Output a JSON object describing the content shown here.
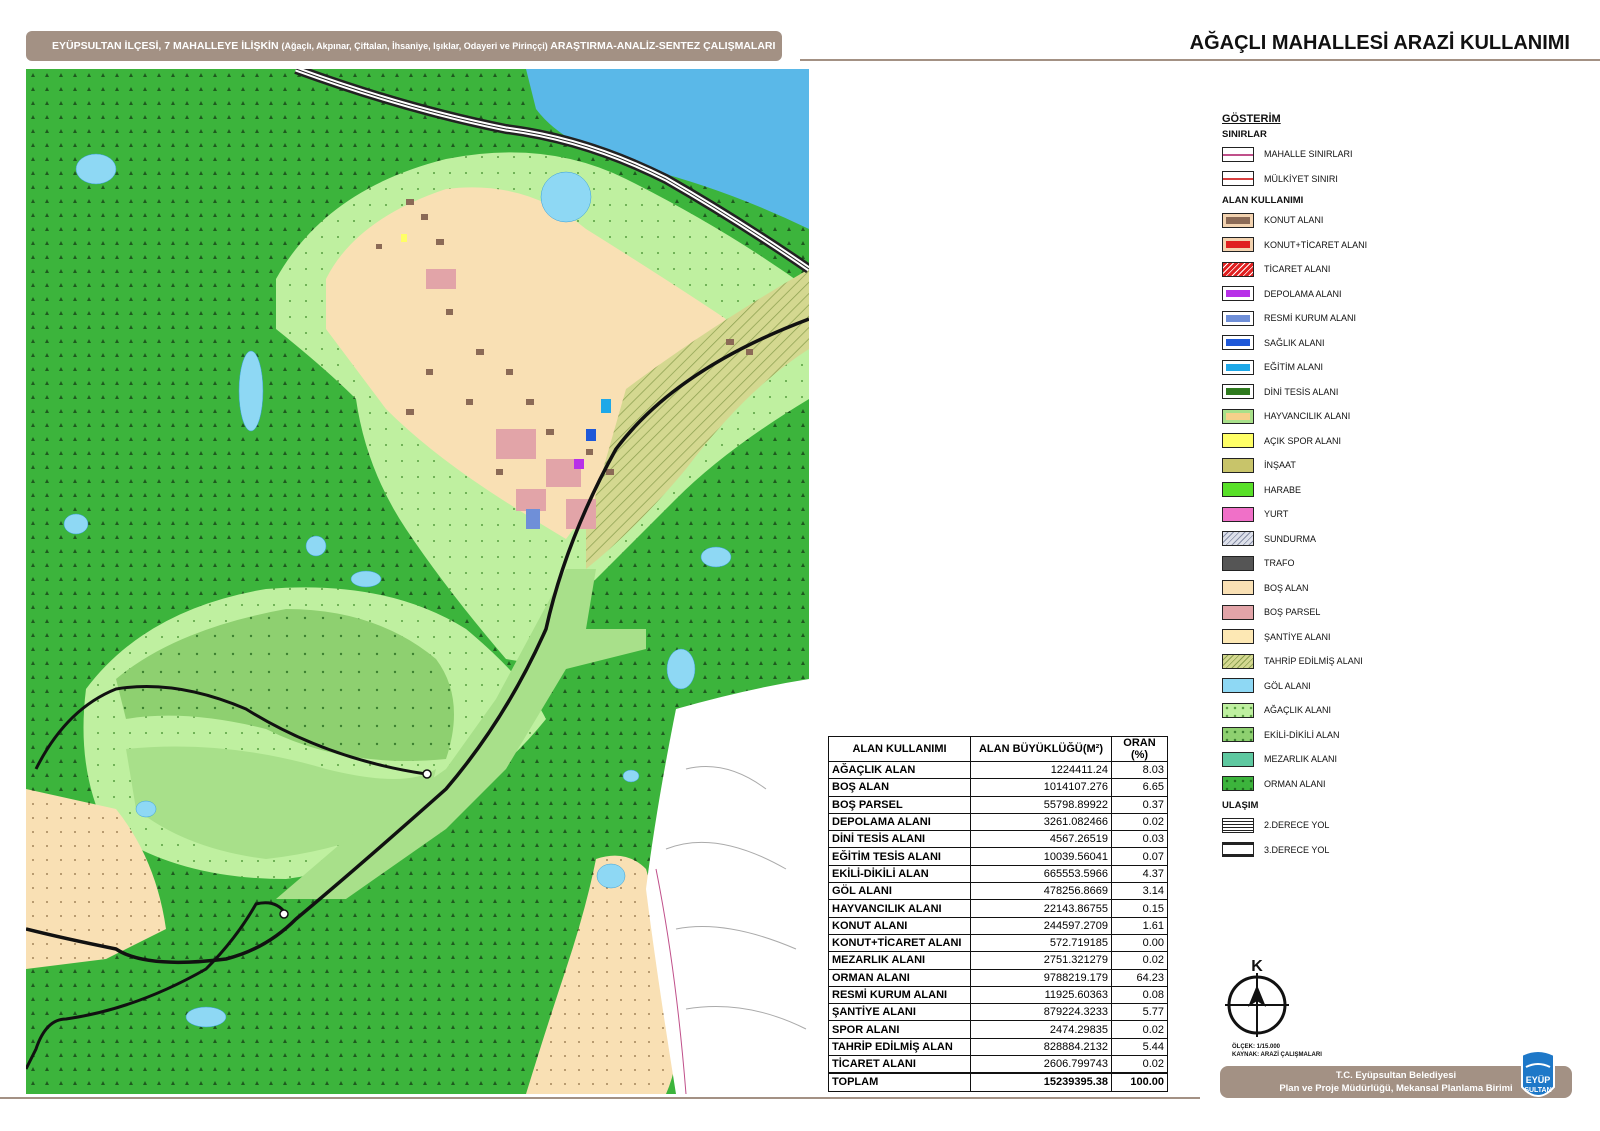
{
  "header": {
    "main": "EYÜPSULTAN İLÇESİ, 7 MAHALLEYE İLİŞKİN",
    "sub": "(Ağaçlı, Akpınar, Çiftalan, İhsaniye, Işıklar, Odayeri ve Pirinççi)",
    "tail": "ARAŞTIRMA-ANALİZ-SENTEZ ÇALIŞMALARI"
  },
  "title": "AĞAÇLI MAHALLESİ ARAZİ KULLANIMI",
  "legend": {
    "heading": "GÖSTERİM",
    "sections": [
      {
        "title": "SINIRLAR",
        "items": [
          {
            "label": "MAHALLE SINIRLARI",
            "fill": "#ffffff",
            "line": "#c0508a",
            "style": "line"
          },
          {
            "label": "MÜLKİYET SINIRI",
            "fill": "#ffffff",
            "line": "#d84040",
            "style": "line"
          }
        ]
      },
      {
        "title": "ALAN KULLANIMI",
        "items": [
          {
            "label": "KONUT ALANI",
            "fill": "#8b6a56",
            "line": "#f3d3b0",
            "style": "inner"
          },
          {
            "label": "KONUT+TİCARET ALANI",
            "fill": "#e02020",
            "line": "#f3d3b0",
            "style": "inner"
          },
          {
            "label": "TİCARET ALANI",
            "fill": "#e02020",
            "line": "#ffffff",
            "style": "hatch"
          },
          {
            "label": "DEPOLAMA ALANI",
            "fill": "#b830e8",
            "line": "#ffffff",
            "style": "inner"
          },
          {
            "label": "RESMİ KURUM ALANI",
            "fill": "#6f8fd8",
            "line": "#ffffff",
            "style": "inner"
          },
          {
            "label": "SAĞLIK ALANI",
            "fill": "#1e58d8",
            "line": "#ffffff",
            "style": "inner"
          },
          {
            "label": "EĞİTİM ALANI",
            "fill": "#1ea8e8",
            "line": "#ffffff",
            "style": "inner"
          },
          {
            "label": "DİNİ TESİS ALANI",
            "fill": "#2e7a1e",
            "line": "#ffffff",
            "style": "inner"
          },
          {
            "label": "HAYVANCILIK ALANI",
            "fill": "#f5d08a",
            "line": "#a8e08a",
            "style": "inner"
          },
          {
            "label": "AÇIK SPOR ALANI",
            "fill": "#ffff66",
            "line": "#ffff66",
            "style": "solid"
          },
          {
            "label": "İNŞAAT",
            "fill": "#c8c46a",
            "line": "#c8c46a",
            "style": "solid"
          },
          {
            "label": "HARABE",
            "fill": "#58e028",
            "line": "#58e028",
            "style": "solid"
          },
          {
            "label": "YURT",
            "fill": "#f070c8",
            "line": "#f070c8",
            "style": "solid"
          },
          {
            "label": "SUNDURMA",
            "fill": "#dde0ea",
            "line": "#8890a8",
            "style": "hatch"
          },
          {
            "label": "TRAFO",
            "fill": "#555555",
            "line": "#555555",
            "style": "solid"
          },
          {
            "label": "BOŞ ALAN",
            "fill": "#f9e0b4",
            "line": "#f9e0b4",
            "style": "dots"
          },
          {
            "label": "BOŞ PARSEL",
            "fill": "#e2a4a8",
            "line": "#e2a4a8",
            "style": "solid"
          },
          {
            "label": "ŞANTİYE ALANI",
            "fill": "#fde8b4",
            "line": "#fde8b4",
            "style": "solid"
          },
          {
            "label": "TAHRİP EDİLMİŞ ALANI",
            "fill": "#d4d890",
            "line": "#8ca050",
            "style": "hatch"
          },
          {
            "label": "GÖL ALANI",
            "fill": "#8ed8f4",
            "line": "#8ed8f4",
            "style": "solid"
          },
          {
            "label": "AĞAÇLIK ALANI",
            "fill": "#bff0a0",
            "line": "#58a040",
            "style": "dots"
          },
          {
            "label": "EKİLİ-DİKİLİ ALAN",
            "fill": "#8ed070",
            "line": "#3c8030",
            "style": "dots"
          },
          {
            "label": "MEZARLIK ALANI",
            "fill": "#5ec8a0",
            "line": "#5ec8a0",
            "style": "solid"
          },
          {
            "label": "ORMAN ALANI",
            "fill": "#3cb43c",
            "line": "#1e6a1e",
            "style": "dots"
          }
        ]
      },
      {
        "title": "ULAŞIM",
        "items": [
          {
            "label": "2.DERECE YOL",
            "fill": "#ffffff",
            "line": "#222222",
            "style": "road2"
          },
          {
            "label": "3.DERECE YOL",
            "fill": "#ffffff",
            "line": "#222222",
            "style": "road3"
          }
        ]
      }
    ]
  },
  "table": {
    "headers": [
      "ALAN KULLANIMI",
      "ALAN BÜYÜKLÜĞÜ(M²)",
      "ORAN (%)"
    ],
    "rows": [
      {
        "name": "AĞAÇLIK ALAN",
        "area": "1224411.24",
        "ratio": "8.03"
      },
      {
        "name": "BOŞ ALAN",
        "area": "1014107.276",
        "ratio": "6.65"
      },
      {
        "name": "BOŞ PARSEL",
        "area": "55798.89922",
        "ratio": "0.37"
      },
      {
        "name": "DEPOLAMA ALANI",
        "area": "3261.082466",
        "ratio": "0.02"
      },
      {
        "name": "DİNİ TESİS ALANI",
        "area": "4567.26519",
        "ratio": "0.03"
      },
      {
        "name": "EĞİTİM TESİS ALANI",
        "area": "10039.56041",
        "ratio": "0.07"
      },
      {
        "name": "EKİLİ-DİKİLİ ALAN",
        "area": "665553.5966",
        "ratio": "4.37"
      },
      {
        "name": "GÖL ALANI",
        "area": "478256.8669",
        "ratio": "3.14"
      },
      {
        "name": "HAYVANCILIK ALANI",
        "area": "22143.86755",
        "ratio": "0.15"
      },
      {
        "name": "KONUT ALANI",
        "area": "244597.2709",
        "ratio": "1.61"
      },
      {
        "name": "KONUT+TİCARET ALANI",
        "area": "572.719185",
        "ratio": "0.00"
      },
      {
        "name": "MEZARLIK ALANI",
        "area": "2751.321279",
        "ratio": "0.02"
      },
      {
        "name": "ORMAN ALANI",
        "area": "9788219.179",
        "ratio": "64.23"
      },
      {
        "name": "RESMİ KURUM ALANI",
        "area": "11925.60363",
        "ratio": "0.08"
      },
      {
        "name": "ŞANTİYE ALANI",
        "area": "879224.3233",
        "ratio": "5.77"
      },
      {
        "name": "SPOR ALANI",
        "area": "2474.29835",
        "ratio": "0.02"
      },
      {
        "name": "TAHRİP EDİLMİŞ ALAN",
        "area": "828884.2132",
        "ratio": "5.44"
      },
      {
        "name": "TİCARET ALANI",
        "area": "2606.799743",
        "ratio": "0.02"
      }
    ],
    "total": {
      "name": "TOPLAM",
      "area": "15239395.38",
      "ratio": "100.00"
    }
  },
  "compass": {
    "north": "K"
  },
  "scale": {
    "scale_text": "ÖLÇEK: 1/15.000",
    "source_text": "KAYNAK: ARAZİ ÇALIŞMALARI"
  },
  "footer": {
    "line1": "T.C. Eyüpsultan Belediyesi",
    "line2": "Plan ve Proje Müdürlüğü, Mekansal Planlama Birimi"
  },
  "logo": {
    "line1": "EYÜP",
    "line2": "SULTAN",
    "color": "#1e78c8"
  },
  "colors": {
    "accent": "#a39184",
    "forest": "#3cb43c",
    "water": "#8ed8f4"
  }
}
